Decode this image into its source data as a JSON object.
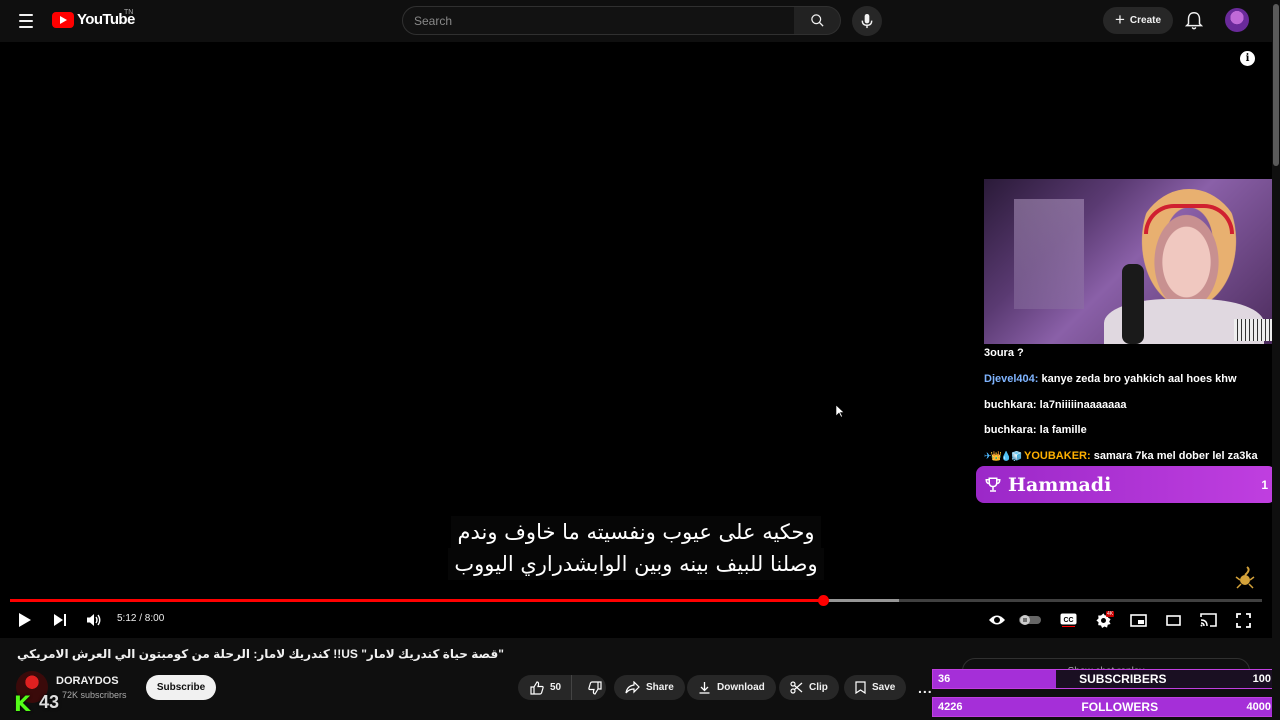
{
  "header": {
    "logo_text": "YouTube",
    "logo_region": "TN",
    "search_placeholder": "Search",
    "create_label": "Create"
  },
  "player": {
    "subtitle_line1": "وحكيه على عيوب ونفسيته ما خاوف وندم",
    "subtitle_line2": "وصلنا للبيف بينه وبين الوابشدراري اليووب",
    "current_time": "5:12",
    "duration": "8:00",
    "time_display": "5:12 / 8:00",
    "played_fraction": 0.65,
    "buffered_fraction": 0.71
  },
  "overlay": {
    "chat": [
      {
        "user": "",
        "message": "3oura ?",
        "color": "#ffffff"
      },
      {
        "user": "Djevel404:",
        "message": "kanye zeda bro yahkich aal hoes khw",
        "color": "#7fb4ff"
      },
      {
        "user": "buchkara:",
        "message": "la7niiiiinaaaaaaa",
        "color": "#ffffff"
      },
      {
        "user": "buchkara:",
        "message": "la famille",
        "color": "#ffffff"
      },
      {
        "user": "YOUBAKER:",
        "message": "samara 7ka mel dober lel za3ka",
        "color": "#ffb000",
        "emotes": "✈👑💧🧊"
      }
    ],
    "top_donor_name": "Hammadi",
    "top_donor_count": "1",
    "subscribers_goal": {
      "current": "36",
      "label": "SUBSCRIBERS",
      "target": "100",
      "fraction": 0.36
    },
    "followers_goal": {
      "current": "4226",
      "label": "FOLLOWERS",
      "target": "4000",
      "fraction": 1.0
    },
    "viewer_count": "43",
    "kick_letter": "K"
  },
  "video": {
    "title": "\"قصة حياة كندريك لامار\" US!! كندريك لامار: الرحلة من كومبتون الي العرش الامريكي",
    "channel_name": "DORAYDOS",
    "subscriber_count": "72K subscribers",
    "subscribe_label": "Subscribe",
    "like_count": "50",
    "share_label": "Share",
    "download_label": "Download",
    "clip_label": "Clip",
    "save_label": "Save",
    "more_label": "...",
    "show_chat_label": "Show chat replay"
  },
  "colors": {
    "accent_red": "#ff0000",
    "overlay_purple": "#c03fe0",
    "kick_green": "#53fc18"
  }
}
